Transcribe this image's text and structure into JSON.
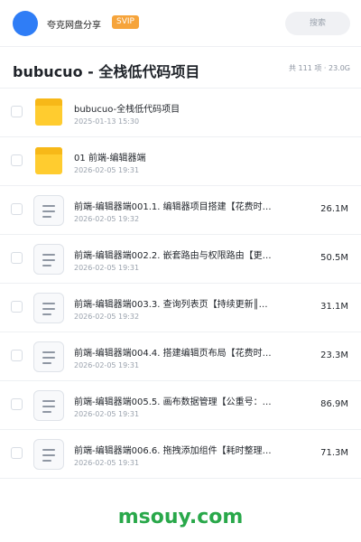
{
  "header": {
    "brand": "夸克网盘分享",
    "badge": "SVIP",
    "search_placeholder": "搜索"
  },
  "folder": {
    "title": "bubucuo - 全栈低代码项目",
    "meta": "共 111 项 · 23.0G"
  },
  "items": [
    {
      "type": "folder",
      "name": "bubucuo-全栈低代码项目",
      "date": "2025-01-13 15:30",
      "size": ""
    },
    {
      "type": "folder",
      "name": "01 前端-编辑器端",
      "date": "2026-02-05 19:31",
      "size": ""
    },
    {
      "type": "file",
      "name": "前端-编辑器端001.1. 编辑器项目搭建【花费时…",
      "date": "2026-02-05 19:32",
      "size": "26.1M"
    },
    {
      "type": "file",
      "name": "前端-编辑器端002.2. 嵌套路由与权限路由【更…",
      "date": "2026-02-05 19:31",
      "size": "50.5M"
    },
    {
      "type": "file",
      "name": "前端-编辑器端003.3. 查询列表页【持续更新║…",
      "date": "2026-02-05 19:32",
      "size": "31.1M"
    },
    {
      "type": "file",
      "name": "前端-编辑器端004.4. 搭建编辑页布局【花费时…",
      "date": "2026-02-05 19:31",
      "size": "23.3M"
    },
    {
      "type": "file",
      "name": "前端-编辑器端005.5. 画布数据管理【公重号：…",
      "date": "2026-02-05 19:31",
      "size": "86.9M"
    },
    {
      "type": "file",
      "name": "前端-编辑器端006.6. 拖拽添加组件【耗时整理…",
      "date": "2026-02-05 19:31",
      "size": "71.3M"
    }
  ],
  "watermark": "msouy.com",
  "colors": {
    "accent": "#2f7df6",
    "badge": "#f6a43b",
    "folder": "#ffcc2f",
    "watermark": "#29a84a"
  }
}
